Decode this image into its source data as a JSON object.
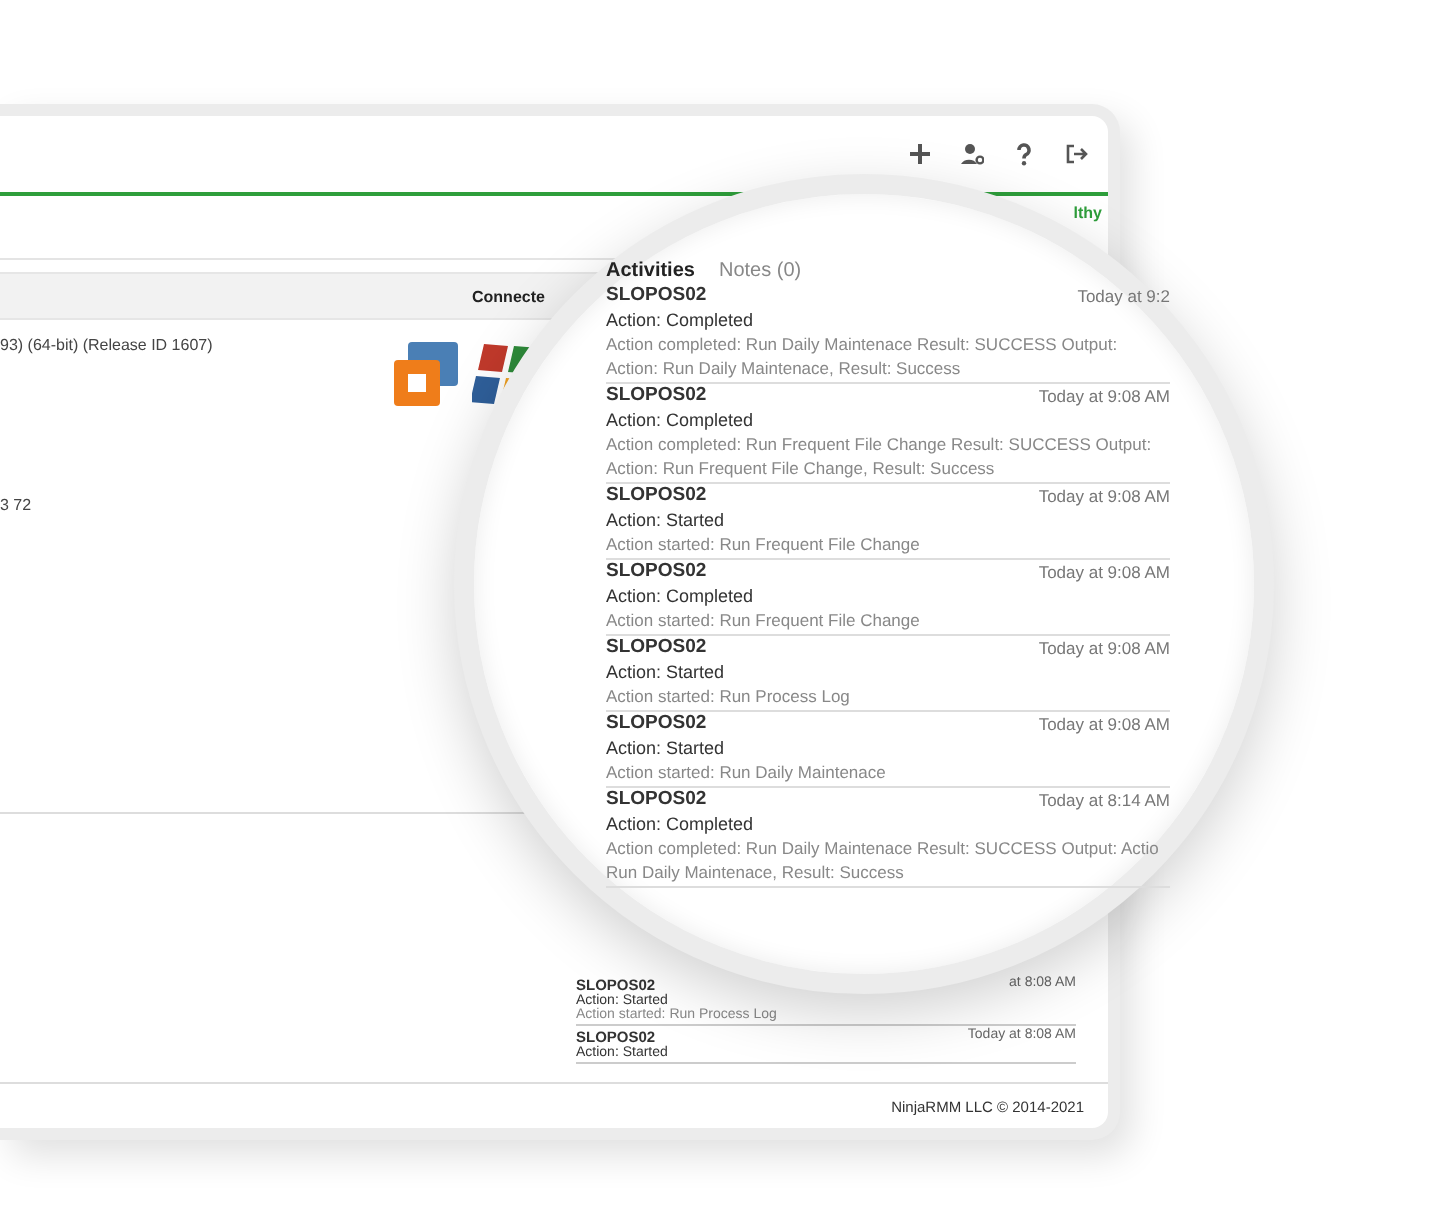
{
  "header": {
    "status_text": "lthy"
  },
  "table": {
    "column_header": "Connecte",
    "cells": [
      "93) (64-bit) (Release ID 1607)",
      "3 72"
    ]
  },
  "lens": {
    "tabs": [
      {
        "label": "Activities",
        "selected": true
      },
      {
        "label": "Notes (0)",
        "selected": false
      }
    ],
    "activities": [
      {
        "device": "SLOPOS02",
        "time": "Today at 9:2",
        "action": "Action: Completed",
        "detail": "Action completed: Run Daily Maintenace Result: SUCCESS Output: Action: Run Daily Maintenace, Result: Success"
      },
      {
        "device": "SLOPOS02",
        "time": "Today at 9:08 AM",
        "action": "Action: Completed",
        "detail": "Action completed: Run Frequent File Change Result: SUCCESS Output: Action: Run Frequent File Change, Result: Success"
      },
      {
        "device": "SLOPOS02",
        "time": "Today at 9:08 AM",
        "action": "Action: Started",
        "detail": "Action started: Run Frequent File Change"
      },
      {
        "device": "SLOPOS02",
        "time": "Today at 9:08 AM",
        "action": "Action: Completed",
        "detail": "Action started: Run Frequent File Change"
      },
      {
        "device": "SLOPOS02",
        "time": "Today at 9:08 AM",
        "action": "Action: Started",
        "detail": "Action started: Run Process Log"
      },
      {
        "device": "SLOPOS02",
        "time": "Today at 9:08 AM",
        "action": "Action: Started",
        "detail": "Action started: Run Daily Maintenace"
      },
      {
        "device": "SLOPOS02",
        "time": "Today at 8:14 AM",
        "action": "Action: Completed",
        "detail": "Action completed: Run Daily Maintenace Result: SUCCESS Output: Actio Run Daily Maintenace, Result: Success"
      }
    ]
  },
  "background_activities": [
    {
      "device": "SLOPOS02",
      "time": "at 8:08 AM",
      "action": "Action: Started",
      "detail": "Action started: Run Process Log"
    },
    {
      "device": "SLOPOS02",
      "time": "Today at 8:08 AM",
      "action": "Action: Started"
    }
  ],
  "footer": "NinjaRMM LLC © 2014-2021"
}
